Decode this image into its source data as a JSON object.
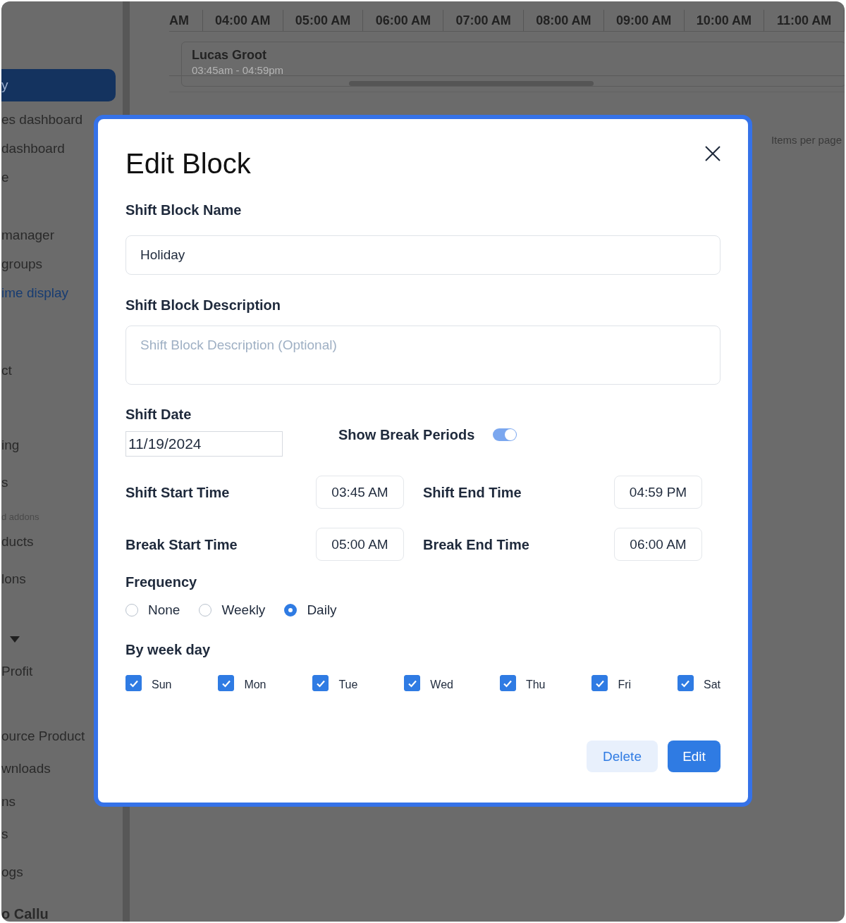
{
  "sidebar": {
    "items": [
      {
        "kind": "link",
        "label": "y",
        "selected": true
      },
      {
        "kind": "link",
        "label": "es dashboard",
        "selected": false
      },
      {
        "kind": "link",
        "label": "dashboard",
        "selected": false
      },
      {
        "kind": "link",
        "label": "e",
        "selected": false
      },
      {
        "kind": "link",
        "label": "manager",
        "selected": false
      },
      {
        "kind": "link",
        "label": "groups",
        "selected": false
      },
      {
        "kind": "current",
        "label": "ime display",
        "selected": false
      },
      {
        "kind": "link",
        "label": "ct",
        "selected": false
      },
      {
        "kind": "link",
        "label": "ing",
        "selected": false
      },
      {
        "kind": "link",
        "label": "s",
        "selected": false
      },
      {
        "kind": "section",
        "label": "d addons"
      },
      {
        "kind": "link",
        "label": "ducts",
        "selected": false
      },
      {
        "kind": "link",
        "label": "lons",
        "selected": false
      },
      {
        "kind": "caret"
      },
      {
        "kind": "link",
        "label": "Profit",
        "selected": false
      },
      {
        "kind": "link",
        "label": "ource Product",
        "selected": false
      },
      {
        "kind": "link",
        "label": "wnloads",
        "selected": false
      },
      {
        "kind": "link",
        "label": "ns",
        "selected": false
      },
      {
        "kind": "link",
        "label": "s",
        "selected": false
      },
      {
        "kind": "link",
        "label": "ogs",
        "selected": false
      },
      {
        "kind": "heading",
        "label": "o Callu"
      }
    ]
  },
  "timeline": {
    "hours": [
      "AM",
      "04:00 AM",
      "05:00 AM",
      "06:00 AM",
      "07:00 AM",
      "08:00 AM",
      "09:00 AM",
      "10:00 AM",
      "11:00 AM"
    ],
    "shift": {
      "name": "Lucas Groot",
      "time": "03:45am - 04:59pm"
    }
  },
  "pagination": {
    "label": "Items per page"
  },
  "modal": {
    "title": "Edit Block",
    "name_field": {
      "label": "Shift Block Name",
      "value": "Holiday"
    },
    "description_field": {
      "label": "Shift Block Description",
      "placeholder": "Shift Block Description (Optional)"
    },
    "date_field": {
      "label": "Shift Date",
      "value": "11/19/2024"
    },
    "break_toggle": {
      "label": "Show Break Periods",
      "on": true
    },
    "times": [
      {
        "label": "Shift Start Time",
        "value": "03:45 AM"
      },
      {
        "label": "Shift End Time",
        "value": "04:59 PM"
      },
      {
        "label": "Break Start Time",
        "value": "05:00 AM"
      },
      {
        "label": "Break End Time",
        "value": "06:00 AM"
      }
    ],
    "frequency": {
      "label": "Frequency",
      "options": [
        {
          "label": "None",
          "selected": false
        },
        {
          "label": "Weekly",
          "selected": false
        },
        {
          "label": "Daily",
          "selected": true
        }
      ]
    },
    "week_days": {
      "label": "By week day",
      "days": [
        {
          "label": "Sun",
          "checked": true
        },
        {
          "label": "Mon",
          "checked": true
        },
        {
          "label": "Tue",
          "checked": true
        },
        {
          "label": "Wed",
          "checked": true
        },
        {
          "label": "Thu",
          "checked": true
        },
        {
          "label": "Fri",
          "checked": true
        },
        {
          "label": "Sat",
          "checked": true
        }
      ]
    },
    "buttons": [
      {
        "label": "Delete",
        "kind": "secondary"
      },
      {
        "label": "Edit",
        "kind": "primary"
      }
    ]
  }
}
